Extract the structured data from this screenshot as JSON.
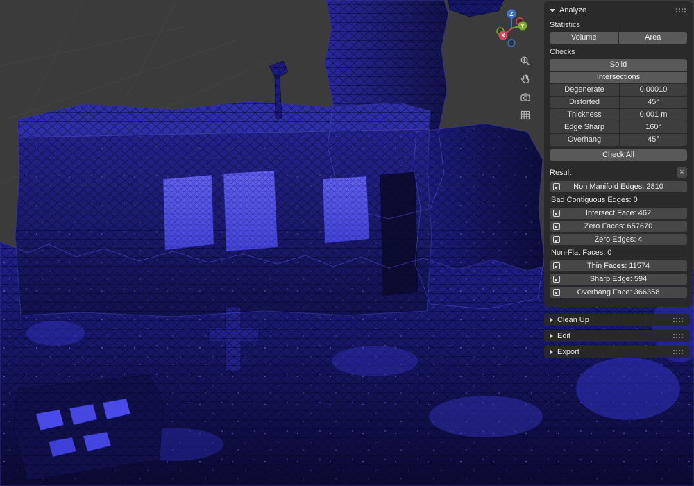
{
  "viewport": {
    "gizmo": {
      "x_label": "X",
      "y_label": "Y",
      "z_label": "Z"
    },
    "tools": {
      "zoom_icon": "magnifier-plus",
      "pan_icon": "hand",
      "camera_icon": "camera",
      "ortho_icon": "grid"
    }
  },
  "panel": {
    "header": {
      "title": "Analyze"
    },
    "statistics": {
      "label": "Statistics",
      "volume_button": "Volume",
      "area_button": "Area"
    },
    "checks": {
      "label": "Checks",
      "solid_button": "Solid",
      "intersections_button": "Intersections",
      "rows": [
        {
          "label": "Degenerate",
          "value": "0.00010"
        },
        {
          "label": "Distorted",
          "value": "45°"
        },
        {
          "label": "Thickness",
          "value": "0.001 m"
        },
        {
          "label": "Edge Sharp",
          "value": "160°"
        },
        {
          "label": "Overhang",
          "value": "45°"
        }
      ],
      "check_all_button": "Check All"
    },
    "result": {
      "label": "Result",
      "close_icon": "×",
      "items": [
        {
          "type": "button",
          "label": "Non Manifold Edges: 2810"
        },
        {
          "type": "text",
          "label": "Bad Contiguous Edges: 0"
        },
        {
          "type": "button",
          "label": "Intersect Face: 462"
        },
        {
          "type": "button",
          "label": "Zero Faces: 657670"
        },
        {
          "type": "button",
          "label": "Zero Edges: 4"
        },
        {
          "type": "text",
          "label": "Non-Flat Faces: 0"
        },
        {
          "type": "button",
          "label": "Thin Faces: 11574"
        },
        {
          "type": "button",
          "label": "Sharp Edge: 594"
        },
        {
          "type": "button",
          "label": "Overhang Face: 366358"
        }
      ]
    },
    "collapsed_panels": [
      {
        "label": "Clean Up"
      },
      {
        "label": "Edit"
      },
      {
        "label": "Export"
      }
    ]
  },
  "colors": {
    "mesh_blue": "#2323b4",
    "window_blue": "#5353e6",
    "panel_bg": "#292929",
    "button_bg": "#595959",
    "field_bg": "#3e3e3e",
    "result_button_bg": "#474747",
    "axis_x": "#d2455b",
    "axis_y": "#7ba82a",
    "axis_z": "#3f74c8",
    "viewport_bg": "#3b3b3b"
  }
}
